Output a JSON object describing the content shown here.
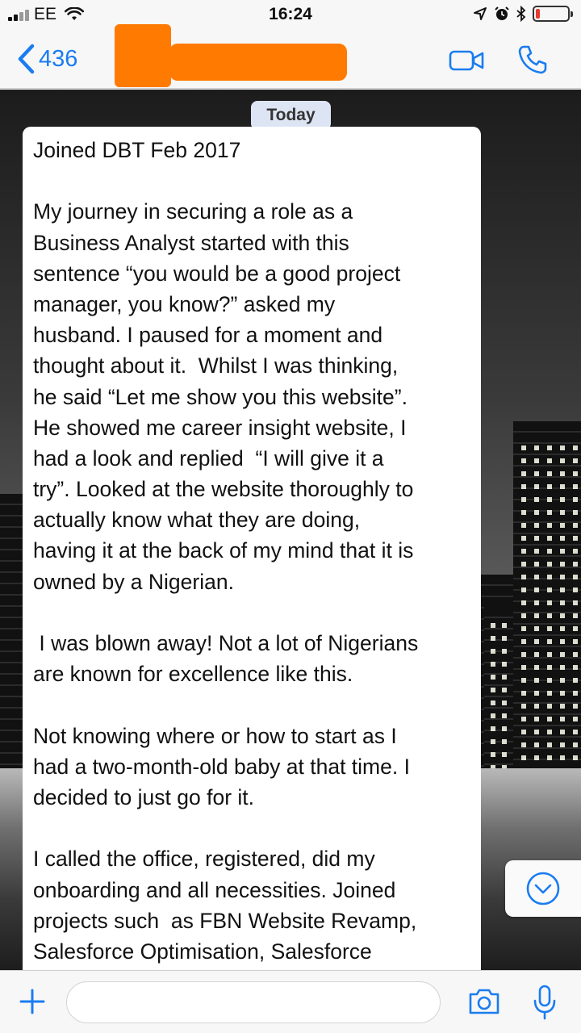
{
  "status_bar": {
    "carrier": "EE",
    "time": "16:24",
    "battery_level": 0.14
  },
  "nav": {
    "back_count": "436",
    "accent_color": "#1a7cf0",
    "redaction_color": "#ff7a00"
  },
  "chat": {
    "date_label": "Today",
    "message_lines": [
      "Joined DBT Feb 2017",
      "",
      "My journey in securing a role as a",
      "Business Analyst started with this",
      "sentence “you would be a good project",
      "manager, you know?” asked my",
      "husband. I paused for a moment and",
      "thought about it.  Whilst I was thinking,",
      "he said “Let me show you this website”.",
      "He showed me career insight website, I",
      "had a look and replied  “I will give it a",
      "try”. Looked at the website thoroughly to",
      "actually know what they are doing,",
      "having it at the back of my mind that it is",
      "owned by a Nigerian.",
      "",
      " I was blown away! Not a lot of Nigerians",
      "are known for excellence like this.",
      "",
      "Not knowing where or how to start as I",
      "had a two-month-old baby at that time. I",
      "decided to just go for it.",
      "",
      "I called the office, registered, did my",
      "onboarding and all necessities. Joined",
      "projects such  as FBN Website Revamp,",
      "Salesforce Optimisation, Salesforce"
    ]
  },
  "input": {
    "value": "",
    "placeholder": ""
  },
  "icons": {
    "back": "chevron-left-icon",
    "video": "video-call-icon",
    "phone": "phone-icon",
    "scroll": "chevron-down-circle-icon",
    "plus": "plus-icon",
    "camera": "camera-icon",
    "mic": "microphone-icon"
  }
}
